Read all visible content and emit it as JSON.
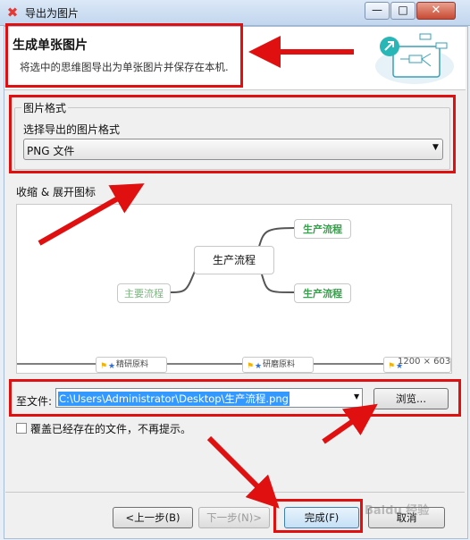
{
  "window": {
    "title": "导出为图片",
    "minimize": "—",
    "maximize": "□",
    "close": "✕"
  },
  "header": {
    "title": "生成单张图片",
    "subtitle": "将选中的思维图导出为单张图片并保存在本机."
  },
  "format": {
    "group_title": "图片格式",
    "label": "选择导出的图片格式",
    "selected": "PNG 文件"
  },
  "preview": {
    "label": "收缩 & 展开图标",
    "central": "生产流程",
    "left_node": "主要流程",
    "right_top": "生产流程",
    "right_bottom": "生产流程",
    "strip": [
      "精研原料",
      "研磨原料"
    ],
    "size_readout": "1200 × 603"
  },
  "output": {
    "label": "至文件:",
    "path": "C:\\Users\\Administrator\\Desktop\\生产流程.png",
    "browse": "浏览...",
    "overwrite_label": "覆盖已经存在的文件，不再提示。",
    "overwrite_checked": false
  },
  "footer": {
    "back": "<上一步(B)",
    "next": "下一步(N)>",
    "finish": "完成(F)",
    "cancel": "取消"
  },
  "watermark": "Baidu 经验",
  "colors": {
    "annotation": "#e01010",
    "selection": "#3399ff",
    "node_green": "#35a14a"
  }
}
